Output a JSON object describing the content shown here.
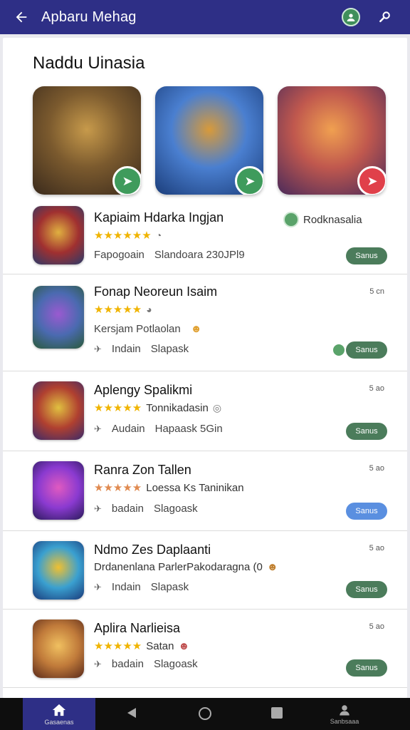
{
  "header": {
    "back_icon": "arrow-left-icon",
    "title": "Apbaru Mehag",
    "account_icon": "account-icon",
    "search_icon": "search-icon"
  },
  "section": {
    "title": "Naddu Uinasia"
  },
  "featured": [
    {
      "badge_icon": "check-icon",
      "badge_color": "#3f9b5c",
      "art": [
        "#3a2a1c",
        "#7b5a2e",
        "#c79a4b"
      ]
    },
    {
      "badge_icon": "check-icon",
      "badge_color": "#3f9b5c",
      "art": [
        "#1b3d7a",
        "#4a7fd0",
        "#d89a3a"
      ]
    },
    {
      "badge_icon": "send-icon",
      "badge_color": "#e0404a",
      "art": [
        "#4a2a5a",
        "#c0584e",
        "#f0a050"
      ]
    }
  ],
  "apps": [
    {
      "name": "Kapiaim Hdarka Ingjan",
      "stars": "★★★★★★",
      "rating_note": "",
      "meta_a": "Fapogoain",
      "meta_b": "Slandoara 230JPl9",
      "size": "",
      "button": "Sanus",
      "developer": "Rodknasalia",
      "art": [
        "#2a3a6a",
        "#a03030",
        "#e0b040"
      ]
    },
    {
      "name": "Fonap Neoreun Isaim",
      "stars": "★★★★★",
      "rating_note": "",
      "meta_a": "Kersjam Potlaolan",
      "meta_b": "",
      "meta_c": "Indain",
      "meta_d": "Slapask",
      "size": "5 cn",
      "button": "Sanus",
      "art": [
        "#2a5a3a",
        "#4a6ab0",
        "#9a5ad0"
      ]
    },
    {
      "name": "Aplengy Spalikmi",
      "stars": "★★★★★",
      "rating_note": "Tonnikadasin",
      "meta_a": "Audain",
      "meta_b": "Hapaask 5Gin",
      "size": "5 ao",
      "button": "Sanus",
      "art": [
        "#3a2a6a",
        "#b04030",
        "#e0c040"
      ]
    },
    {
      "name": "Ranra Zon Tallen",
      "stars": "★★★★★",
      "rating_note": "Loessa Ks Taninikan",
      "meta_a": "badain",
      "meta_b": "Slagoask",
      "size": "5 ao",
      "button": "Sanus",
      "button_style": "blue",
      "art": [
        "#2a1a5a",
        "#8a3ad0",
        "#e05ac0"
      ]
    },
    {
      "name": "Ndmo Zes Daplaanti",
      "stars": "",
      "rating_note": "Drdanenlana ParlerPakodaragna (0",
      "meta_a": "Indain",
      "meta_b": "Slapask",
      "size": "5 ao",
      "button": "Sanus",
      "art": [
        "#1a3a7a",
        "#3aa0d0",
        "#f0c030"
      ]
    },
    {
      "name": "Aplira Narlieisa",
      "stars": "★★★★★",
      "rating_note": "Satan",
      "meta_a": "badain",
      "meta_b": "Slagoask",
      "size": "5 ao",
      "button": "Sanus",
      "art": [
        "#5a2a1a",
        "#c07a3a",
        "#f0c060"
      ]
    }
  ],
  "bottom_nav": {
    "home_label": "Gasaenas",
    "home_icon": "home-icon",
    "back_icon": "triangle-back-icon",
    "circle_icon": "circle-home-icon",
    "square_icon": "square-recents-icon",
    "profile_icon": "person-icon",
    "profile_label": "Sanbsaaa"
  }
}
